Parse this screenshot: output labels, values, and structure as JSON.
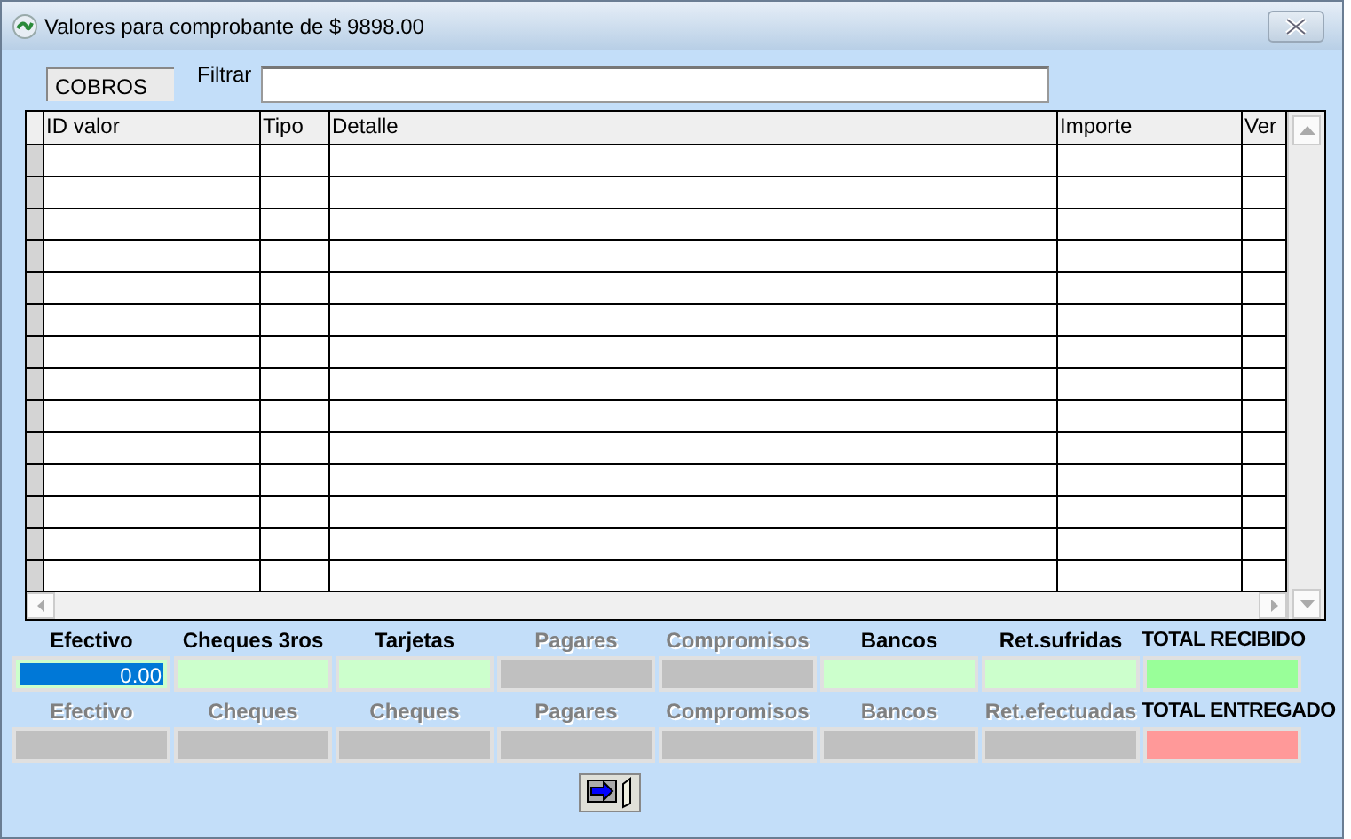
{
  "window": {
    "title": "Valores para comprobante de $ 9898.00"
  },
  "mode": {
    "value": "COBROS"
  },
  "filter": {
    "label": "Filtrar"
  },
  "table": {
    "columns": [
      "ID valor",
      "Tipo",
      "Detalle",
      "Importe",
      "Ver"
    ]
  },
  "received": [
    {
      "label": "Efectivo",
      "disabled": false,
      "color": "#ccffcc",
      "value": "0.00",
      "selected": true
    },
    {
      "label": "Cheques 3ros",
      "disabled": false,
      "color": "#ccffcc",
      "selected": false
    },
    {
      "label": "Tarjetas",
      "disabled": false,
      "color": "#ccffcc",
      "selected": false
    },
    {
      "label": "Pagares",
      "disabled": true,
      "color": "#c0c0c0",
      "selected": false
    },
    {
      "label": "Compromisos",
      "disabled": true,
      "color": "#c0c0c0",
      "selected": false
    },
    {
      "label": "Bancos",
      "disabled": false,
      "color": "#ccffcc",
      "selected": false
    },
    {
      "label": "Ret.sufridas",
      "disabled": false,
      "color": "#ccffcc",
      "selected": false
    },
    {
      "label": "TOTAL RECIBIDO",
      "disabled": false,
      "color": "#99ff99",
      "selected": false
    }
  ],
  "delivered": [
    {
      "label": "Efectivo",
      "disabled": true,
      "color": "#c0c0c0",
      "selected": false
    },
    {
      "label": "Cheques",
      "disabled": true,
      "color": "#c0c0c0",
      "selected": false
    },
    {
      "label": "Cheques",
      "disabled": true,
      "color": "#c0c0c0",
      "selected": false
    },
    {
      "label": "Pagares",
      "disabled": true,
      "color": "#c0c0c0",
      "selected": false
    },
    {
      "label": "Compromisos",
      "disabled": true,
      "color": "#c0c0c0",
      "selected": false
    },
    {
      "label": "Bancos",
      "disabled": true,
      "color": "#c0c0c0",
      "selected": false
    },
    {
      "label": "Ret.efectuadas",
      "disabled": true,
      "color": "#c0c0c0",
      "selected": false
    },
    {
      "label": "TOTAL ENTREGADO",
      "disabled": false,
      "color": "#ff9999",
      "selected": false
    }
  ]
}
